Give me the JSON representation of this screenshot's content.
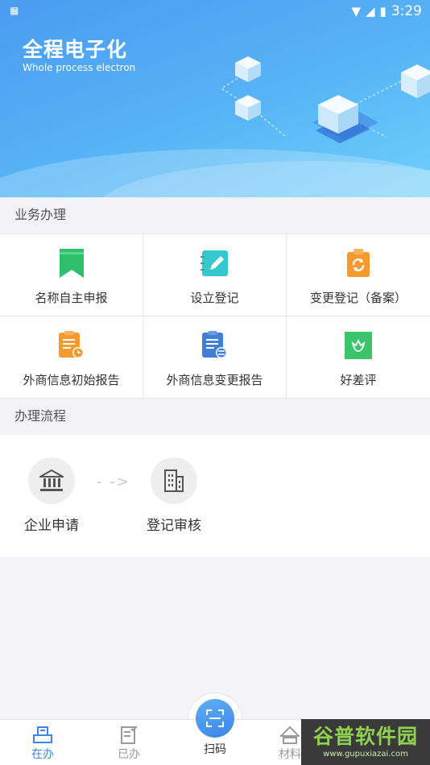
{
  "status_bar": {
    "time": "3:29"
  },
  "banner": {
    "title": "全程电子化",
    "subtitle": "Whole process electron"
  },
  "services": {
    "header": "业务办理",
    "items": [
      {
        "label": "名称自主申报",
        "icon": "bookmark-icon",
        "color": "#2fbf6a"
      },
      {
        "label": "设立登记",
        "icon": "notebook-pen-icon",
        "color": "#35c8cc"
      },
      {
        "label": "变更登记（备案）",
        "icon": "clipboard-refresh-icon",
        "color": "#f59a2e"
      },
      {
        "label": "外商信息初始报告",
        "icon": "clipboard-clock-icon",
        "color": "#f59a2e"
      },
      {
        "label": "外商信息变更报告",
        "icon": "clipboard-switch-icon",
        "color": "#3f7fd8"
      },
      {
        "label": "好差评",
        "icon": "flower-badge-icon",
        "color": "#3cc46a"
      }
    ]
  },
  "process": {
    "header": "办理流程",
    "steps": [
      {
        "label": "企业申请",
        "icon": "bank-building-icon"
      },
      {
        "label": "登记审核",
        "icon": "office-building-icon"
      }
    ]
  },
  "bottom_nav": {
    "items": [
      {
        "label": "在办",
        "icon": "in-progress-icon"
      },
      {
        "label": "已办",
        "icon": "done-document-icon"
      },
      {
        "label": "扫码",
        "icon": "scan-icon"
      },
      {
        "label": "材料",
        "icon": "materials-icon"
      }
    ]
  },
  "watermark": {
    "text": "谷普软件园",
    "url": "www.gupuxiazai.com"
  },
  "colors": {
    "accent": "#3b86e8",
    "banner_start": "#4b9bf0",
    "banner_end": "#6fd0fb"
  }
}
